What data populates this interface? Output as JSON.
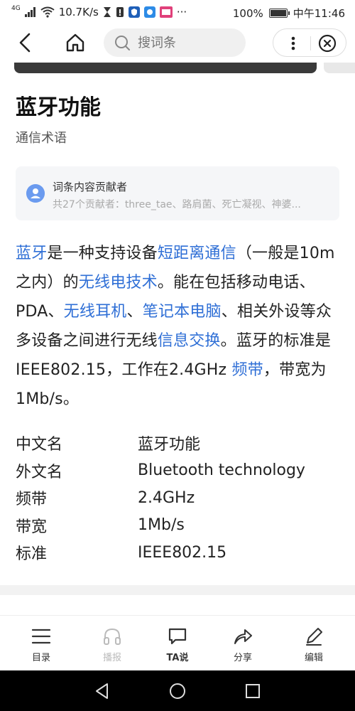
{
  "status_bar": {
    "signal_label": "4G",
    "net_speed": "10.7K/s",
    "battery": "100%",
    "time": "中午11:46"
  },
  "topnav": {
    "search_placeholder": "搜词条"
  },
  "article": {
    "title": "蓝牙功能",
    "subtitle": "通信术语",
    "contributors": {
      "heading": "词条内容贡献者",
      "summary": "共27个贡献者：three_tae、路肩菌、死亡凝视、神婆..."
    },
    "paragraph": [
      {
        "text": "蓝牙",
        "link": true
      },
      {
        "text": "是一种支持设备",
        "link": false
      },
      {
        "text": "短距离通信",
        "link": true
      },
      {
        "text": "（一般是10m之内）的",
        "link": false
      },
      {
        "text": "无线电技术",
        "link": true
      },
      {
        "text": "。能在包括移动电话、PDA、",
        "link": false
      },
      {
        "text": "无线耳机",
        "link": true
      },
      {
        "text": "、",
        "link": false
      },
      {
        "text": "笔记本电脑",
        "link": true
      },
      {
        "text": "、相关外设等众多设备之间进行无线",
        "link": false
      },
      {
        "text": "信息交换",
        "link": true
      },
      {
        "text": "。蓝牙的标准是IEEE802.15，工作在2.4GHz ",
        "link": false
      },
      {
        "text": "频带",
        "link": true
      },
      {
        "text": "，带宽为1Mb/s。",
        "link": false
      }
    ],
    "info": [
      {
        "key": "中文名",
        "value": "蓝牙功能"
      },
      {
        "key": "外文名",
        "value": "Bluetooth technology"
      },
      {
        "key": "频带",
        "value": "2.4GHz"
      },
      {
        "key": "带宽",
        "value": "1Mb/s"
      },
      {
        "key": "标准",
        "value": "IEEE802.15"
      }
    ]
  },
  "toolbar": {
    "catalog": "目录",
    "broadcast": "播报",
    "ta_say": "TA说",
    "share": "分享",
    "edit": "编辑"
  },
  "colors": {
    "link": "#2f6fd6",
    "card_bg": "#f5f6f8"
  }
}
